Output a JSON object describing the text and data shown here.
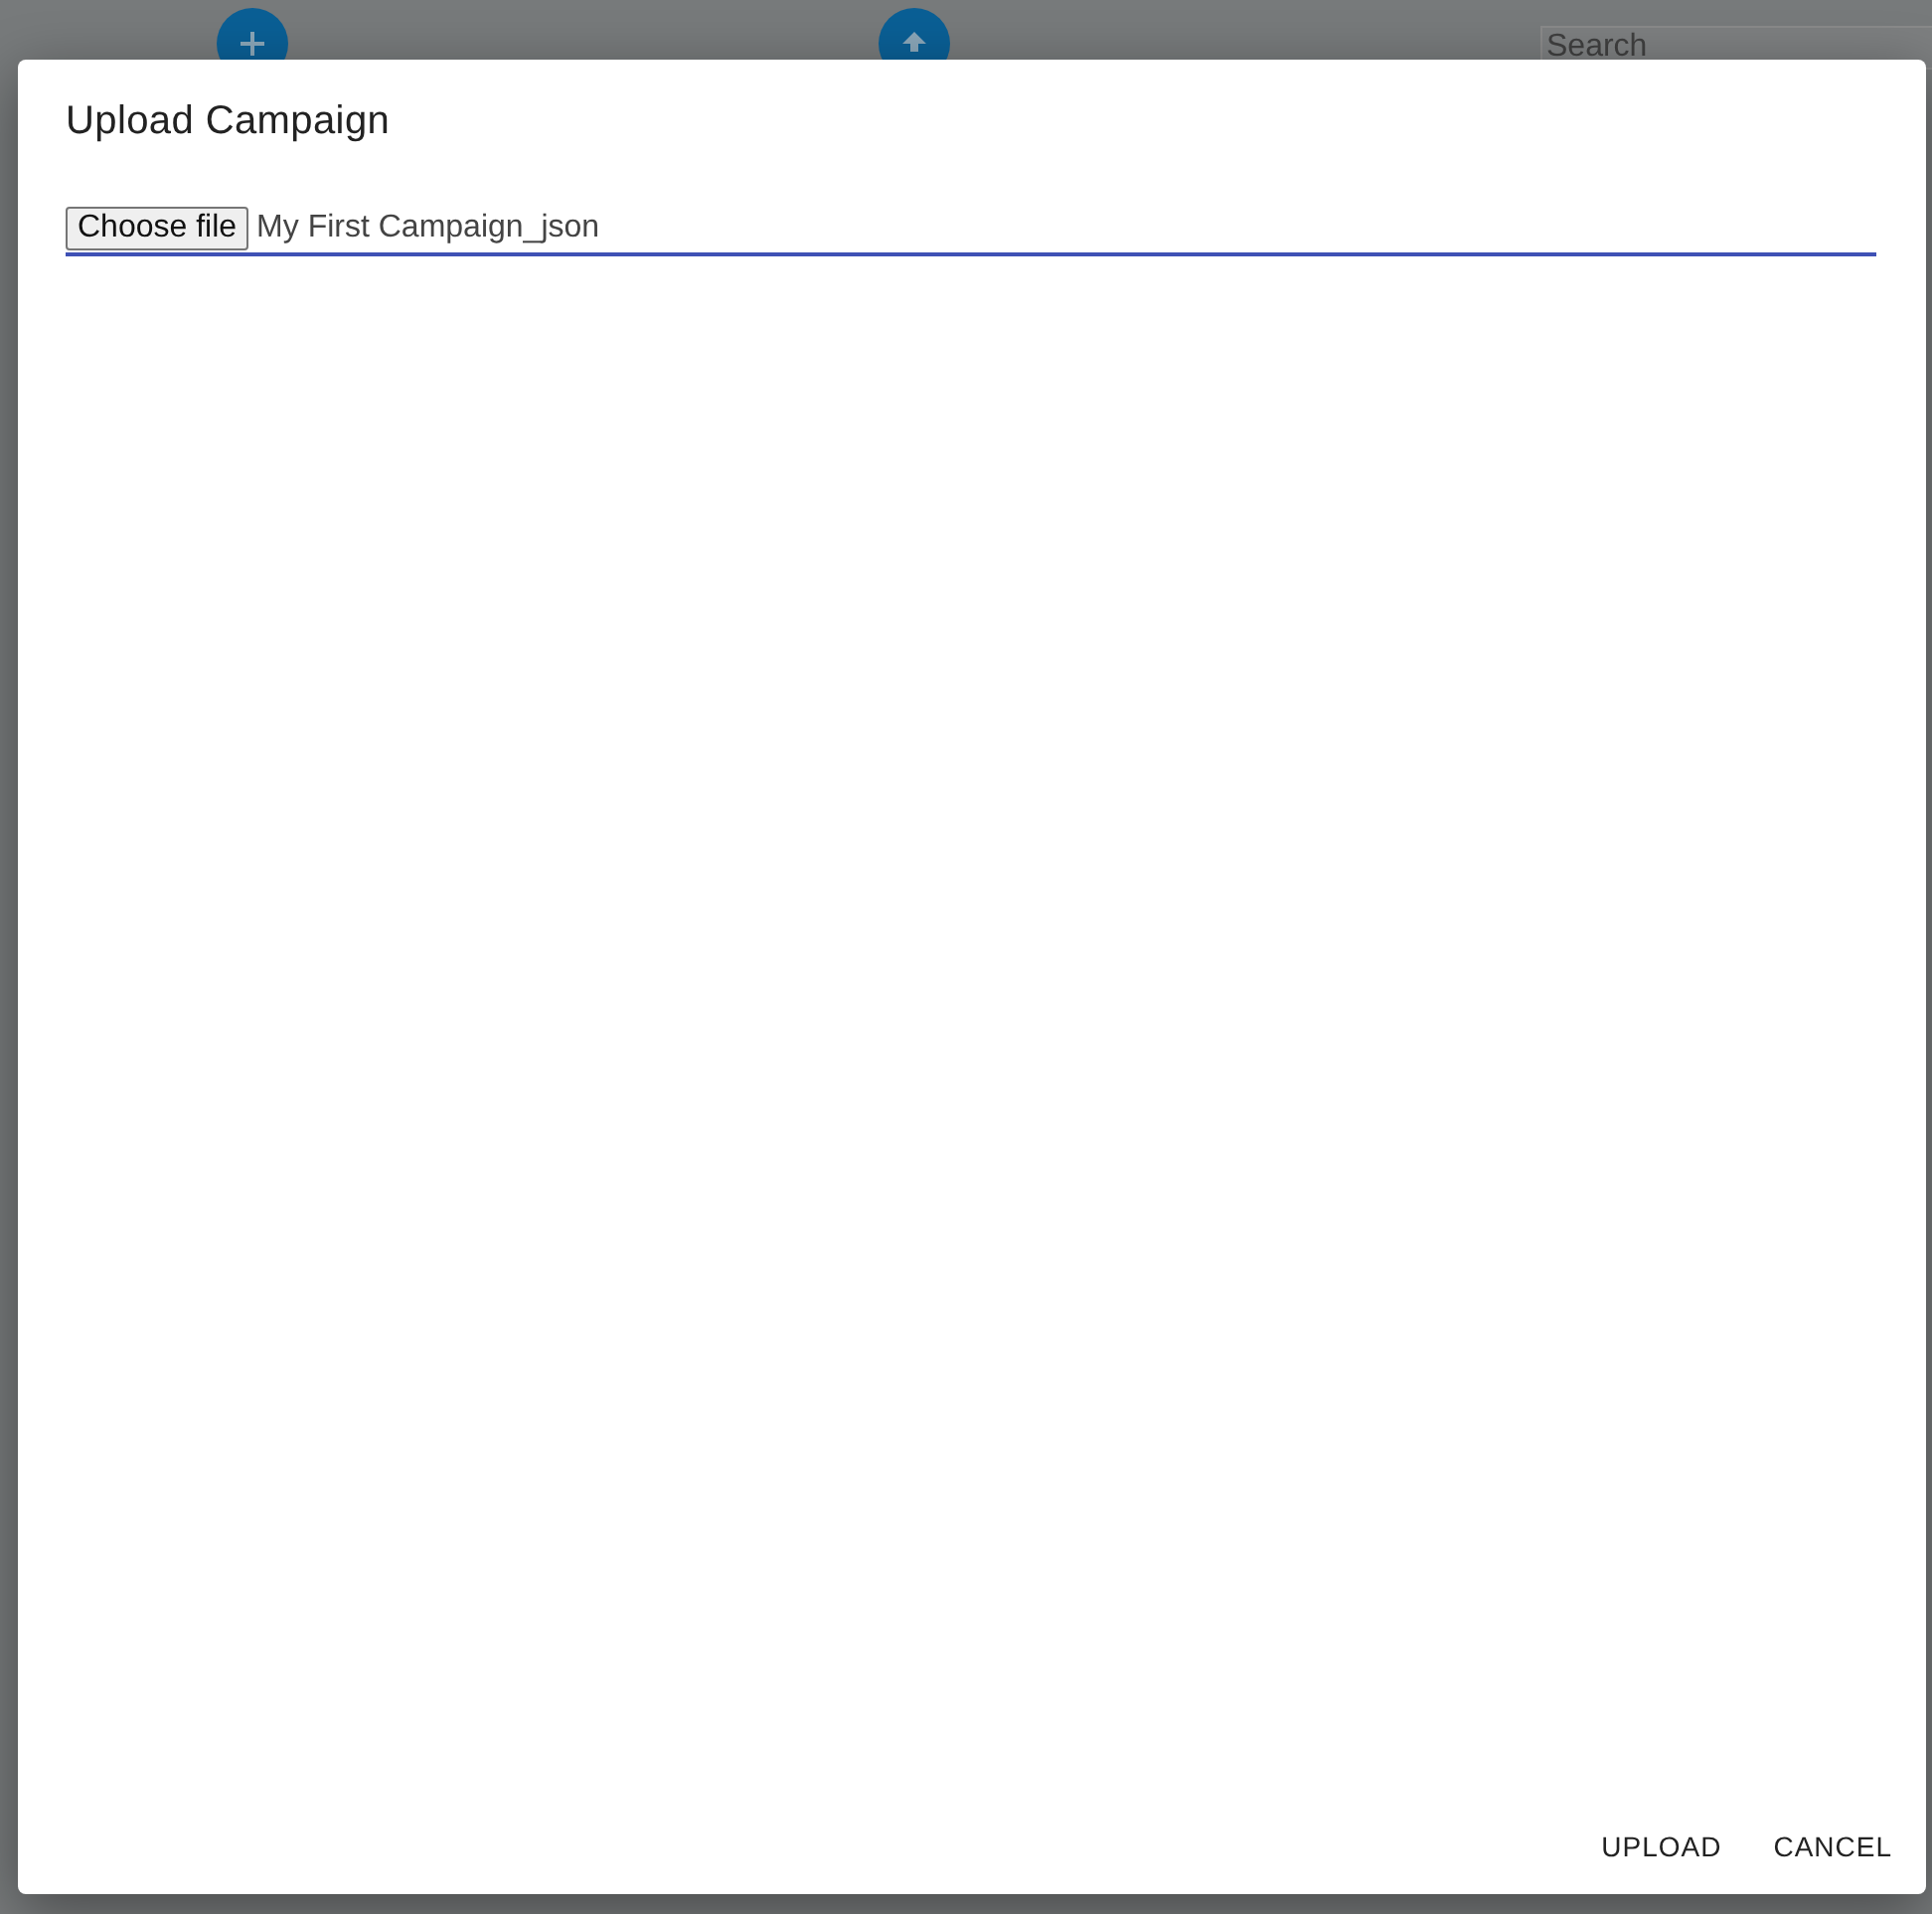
{
  "background": {
    "search": {
      "placeholder": "Search"
    }
  },
  "dialog": {
    "title": "Upload Campaign",
    "file_input": {
      "button": "Choose file",
      "value": "My First Campaign_json"
    },
    "buttons": [
      {
        "label": "UPLOAD"
      },
      {
        "label": "CANCEL"
      }
    ]
  }
}
